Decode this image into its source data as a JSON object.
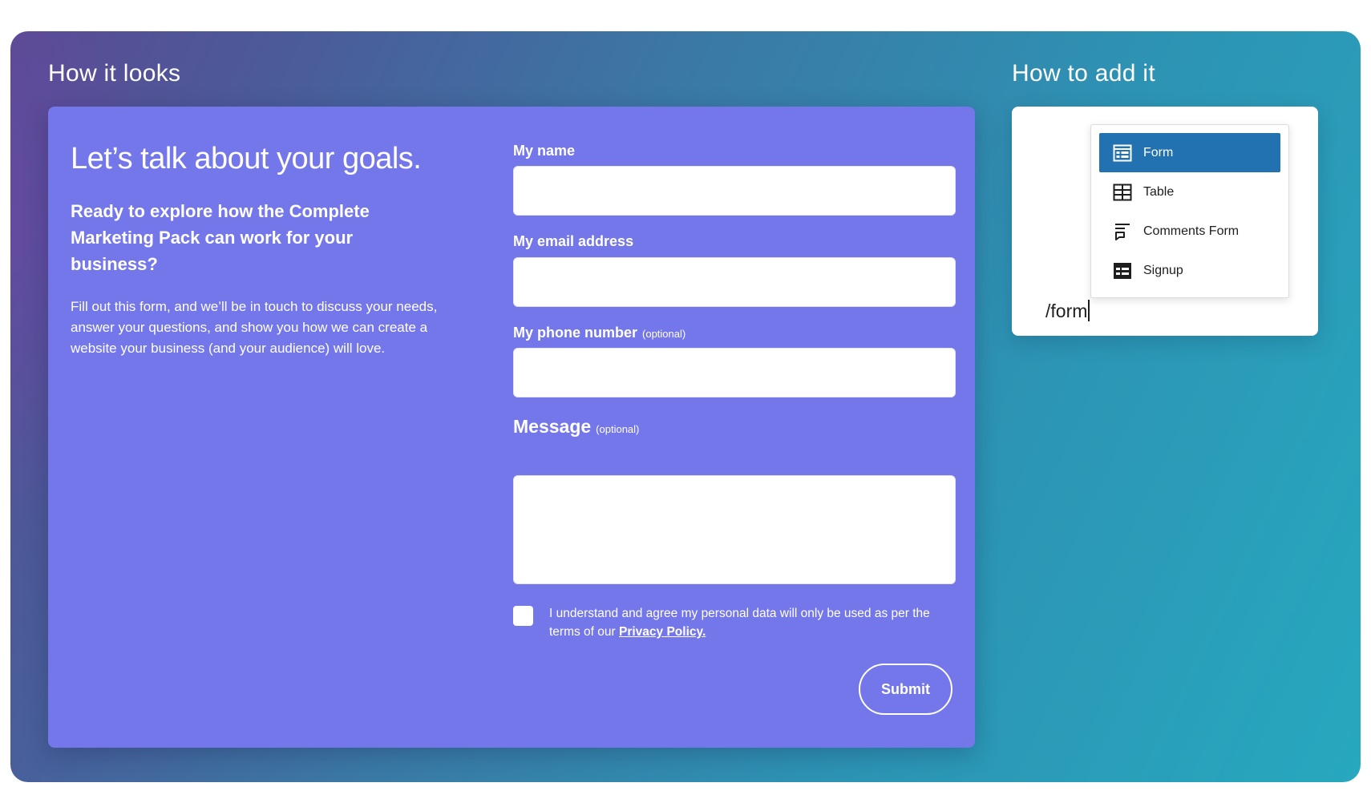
{
  "sections": {
    "left_title": "How it looks",
    "right_title": "How to add it"
  },
  "form_preview": {
    "headline": "Let’s talk about your goals.",
    "subheadline": "Ready to explore how the Complete Marketing Pack can work for your business?",
    "body": "Fill out this form, and we’ll be in touch to discuss your needs, answer your questions, and show you how we can create a website your business (and your audience) will love.",
    "fields": {
      "name": {
        "label": "My name",
        "value": ""
      },
      "email": {
        "label": "My email address",
        "value": ""
      },
      "phone": {
        "label": "My phone number",
        "optional": "(optional)",
        "value": ""
      },
      "message": {
        "label": "Message",
        "optional": "(optional)",
        "value": ""
      }
    },
    "consent": {
      "text": "I understand and agree my personal data will only be used as per the terms of our ",
      "link": "Privacy Policy.",
      "checked": false
    },
    "submit_label": "Submit"
  },
  "how_to_add": {
    "slash_input": "/form",
    "menu_items": [
      {
        "label": "Form",
        "icon": "form-icon",
        "active": true
      },
      {
        "label": "Table",
        "icon": "table-icon",
        "active": false
      },
      {
        "label": "Comments Form",
        "icon": "comments-form-icon",
        "active": false
      },
      {
        "label": "Signup",
        "icon": "signup-icon",
        "active": false
      }
    ]
  },
  "colors": {
    "card_purple": "#7477ea",
    "menu_active": "#2271b1",
    "gradient_start": "#5a4b93",
    "gradient_end": "#27a8bf"
  }
}
